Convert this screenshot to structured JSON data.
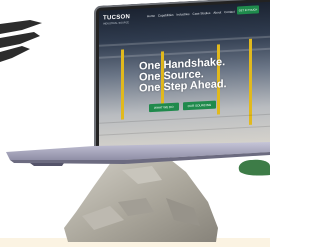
{
  "website": {
    "logo_text": "TUCSON",
    "logo_subtext": "INDUSTRIAL SOURCE",
    "nav_links": [
      "Home",
      "Capabilities",
      "Industries",
      "Case Studies",
      "About",
      "Contact"
    ],
    "nav_cta": "GET IN TOUCH",
    "headline_lines": [
      "One Handshake.",
      "One Source.",
      "One Step Ahead."
    ],
    "primary_button": "WHAT WE DO",
    "secondary_button": "OUR SOURCING"
  },
  "colors": {
    "accent_green": "#1f8a4c",
    "pillar_yellow": "#e1b91d",
    "bottom_band": "#fbf3e2"
  },
  "icons": [
    "dark-swoosh-decoration",
    "green-blob-decoration",
    "rock-pedestal"
  ]
}
